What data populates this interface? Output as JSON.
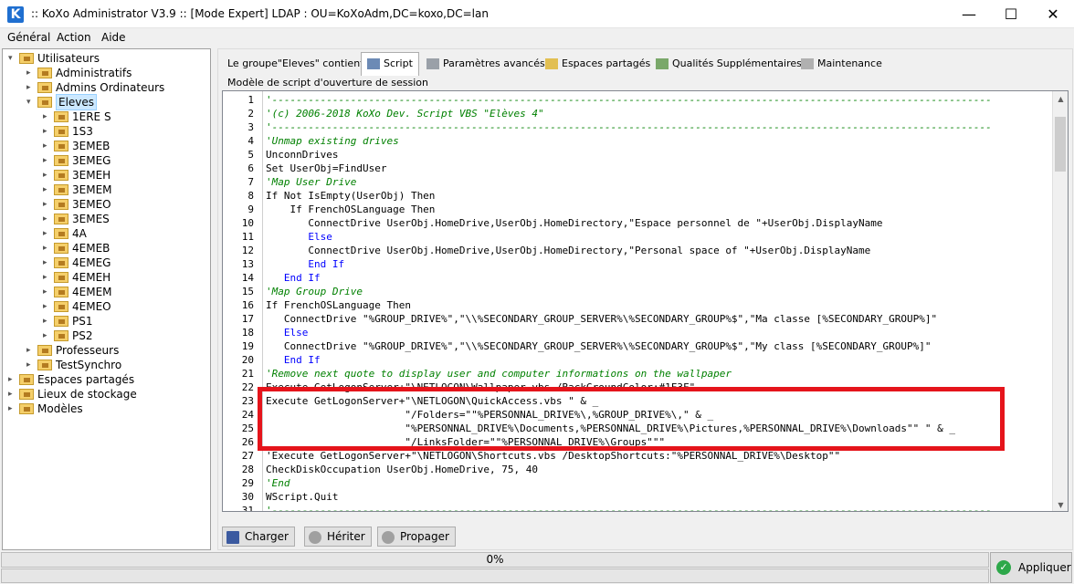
{
  "window": {
    "title": ":: KoXo Administrator V3.9 :: [Mode Expert] LDAP : OU=KoXoAdm,DC=koxo,DC=lan",
    "app_icon_letter": "K"
  },
  "menu": [
    "Général",
    "Action",
    "Aide"
  ],
  "tree": [
    {
      "label": "Utilisateurs"
    },
    {
      "label": "Administratifs"
    },
    {
      "label": "Admins Ordinateurs"
    },
    {
      "label": "Eleves"
    },
    {
      "label": "1ERE S"
    },
    {
      "label": "1S3"
    },
    {
      "label": "3EMEB"
    },
    {
      "label": "3EMEG"
    },
    {
      "label": "3EMEH"
    },
    {
      "label": "3EMEM"
    },
    {
      "label": "3EMEO"
    },
    {
      "label": "3EMES"
    },
    {
      "label": "4A"
    },
    {
      "label": "4EMEB"
    },
    {
      "label": "4EMEG"
    },
    {
      "label": "4EMEH"
    },
    {
      "label": "4EMEM"
    },
    {
      "label": "4EMEO"
    },
    {
      "label": "PS1"
    },
    {
      "label": "PS2"
    },
    {
      "label": "Professeurs"
    },
    {
      "label": "TestSynchro"
    },
    {
      "label": "Espaces partagés"
    },
    {
      "label": "Lieux de stockage"
    },
    {
      "label": "Modèles"
    }
  ],
  "tabs": [
    {
      "label": "Le groupe\"Eleves\" contient",
      "active": false
    },
    {
      "label": "Script",
      "active": true
    },
    {
      "label": "Paramètres avancés",
      "active": false
    },
    {
      "label": "Espaces partagés",
      "active": false
    },
    {
      "label": "Qualités Supplémentaires",
      "active": false
    },
    {
      "label": "Maintenance",
      "active": false
    }
  ],
  "group_caption": "Modèle de script d'ouverture de session",
  "code_lines": [
    {
      "n": "1",
      "text": "'-----------------------------------------------------------------------------------------------------------------------",
      "cls": "c-comment"
    },
    {
      "n": "2",
      "text": "'(c) 2006-2018 KoXo Dev. Script VBS \"Elèves 4\"",
      "cls": "c-comment"
    },
    {
      "n": "3",
      "text": "'-----------------------------------------------------------------------------------------------------------------------",
      "cls": "c-comment"
    },
    {
      "n": "4",
      "text": "'Unmap existing drives",
      "cls": "c-comment"
    },
    {
      "n": "5",
      "text": "UnconnDrives",
      "cls": ""
    },
    {
      "n": "6",
      "text": "Set UserObj=FindUser",
      "cls": ""
    },
    {
      "n": "7",
      "text": "'Map User Drive",
      "cls": "c-comment"
    },
    {
      "n": "8",
      "text": "If Not IsEmpty(UserObj) Then",
      "cls": ""
    },
    {
      "n": "9",
      "text": "    If FrenchOSLanguage Then",
      "cls": ""
    },
    {
      "n": "10",
      "text": "       ConnectDrive UserObj.HomeDrive,UserObj.HomeDirectory,\"Espace personnel de \"+UserObj.DisplayName",
      "cls": ""
    },
    {
      "n": "11",
      "text": "       Else",
      "cls": "c-kw"
    },
    {
      "n": "12",
      "text": "       ConnectDrive UserObj.HomeDrive,UserObj.HomeDirectory,\"Personal space of \"+UserObj.DisplayName",
      "cls": ""
    },
    {
      "n": "13",
      "text": "       End If",
      "cls": "c-kw"
    },
    {
      "n": "14",
      "text": "   End If",
      "cls": "c-kw"
    },
    {
      "n": "15",
      "text": "'Map Group Drive",
      "cls": "c-comment"
    },
    {
      "n": "16",
      "text": "If FrenchOSLanguage Then",
      "cls": ""
    },
    {
      "n": "17",
      "text": "   ConnectDrive \"%GROUP_DRIVE%\",\"\\\\%SECONDARY_GROUP_SERVER%\\%SECONDARY_GROUP%$\",\"Ma classe [%SECONDARY_GROUP%]\"",
      "cls": ""
    },
    {
      "n": "18",
      "text": "   Else",
      "cls": "c-kw"
    },
    {
      "n": "19",
      "text": "   ConnectDrive \"%GROUP_DRIVE%\",\"\\\\%SECONDARY_GROUP_SERVER%\\%SECONDARY_GROUP%$\",\"My class [%SECONDARY_GROUP%]\"",
      "cls": ""
    },
    {
      "n": "20",
      "text": "   End If",
      "cls": "c-kw"
    },
    {
      "n": "21",
      "text": "'Remove next quote to display user and computer informations on the wallpaper",
      "cls": "c-comment"
    },
    {
      "n": "22",
      "text": "Execute GetLogonServer+\"\\NETLOGON\\Wallpaper.vbs /BackGroundColor:#1F3F\"",
      "cls": ""
    },
    {
      "n": "23",
      "text": "Execute GetLogonServer+\"\\NETLOGON\\QuickAccess.vbs \" & _",
      "cls": ""
    },
    {
      "n": "24",
      "text": "                       \"/Folders=\"\"%PERSONNAL_DRIVE%\\,%GROUP_DRIVE%\\,\" & _",
      "cls": ""
    },
    {
      "n": "25",
      "text": "                       \"%PERSONNAL_DRIVE%\\Documents,%PERSONNAL_DRIVE%\\Pictures,%PERSONNAL_DRIVE%\\Downloads\"\" \" & _",
      "cls": ""
    },
    {
      "n": "26",
      "text": "                       \"/LinksFolder=\"\"%PERSONNAL_DRIVE%\\Groups\"\"\"",
      "cls": ""
    },
    {
      "n": "27",
      "text": "'Execute GetLogonServer+\"\\NETLOGON\\Shortcuts.vbs /DesktopShortcuts:\"%PERSONNAL_DRIVE%\\Desktop\"\"",
      "cls": ""
    },
    {
      "n": "28",
      "text": "CheckDiskOccupation UserObj.HomeDrive, 75, 40",
      "cls": ""
    },
    {
      "n": "29",
      "text": "'End",
      "cls": "c-comment"
    },
    {
      "n": "30",
      "text": "WScript.Quit",
      "cls": ""
    },
    {
      "n": "31",
      "text": "'-----------------------------------------------------------------------------------------------------------------------",
      "cls": "c-comment"
    }
  ],
  "buttons": {
    "charger": "Charger",
    "heriter": "Hériter",
    "propager": "Propager"
  },
  "status": {
    "progress_text": "0%",
    "progress": 0,
    "apply_label": "Appliquer"
  },
  "colors": {
    "highlight_box": "#e5141b",
    "accent": "#1f6fd0"
  },
  "icons": {
    "tab_script": "script-icon",
    "tab_params": "params-icon",
    "tab_shares": "shares-icon",
    "tab_qualities": "qualities-icon",
    "tab_maintenance": "maintenance-icon"
  }
}
